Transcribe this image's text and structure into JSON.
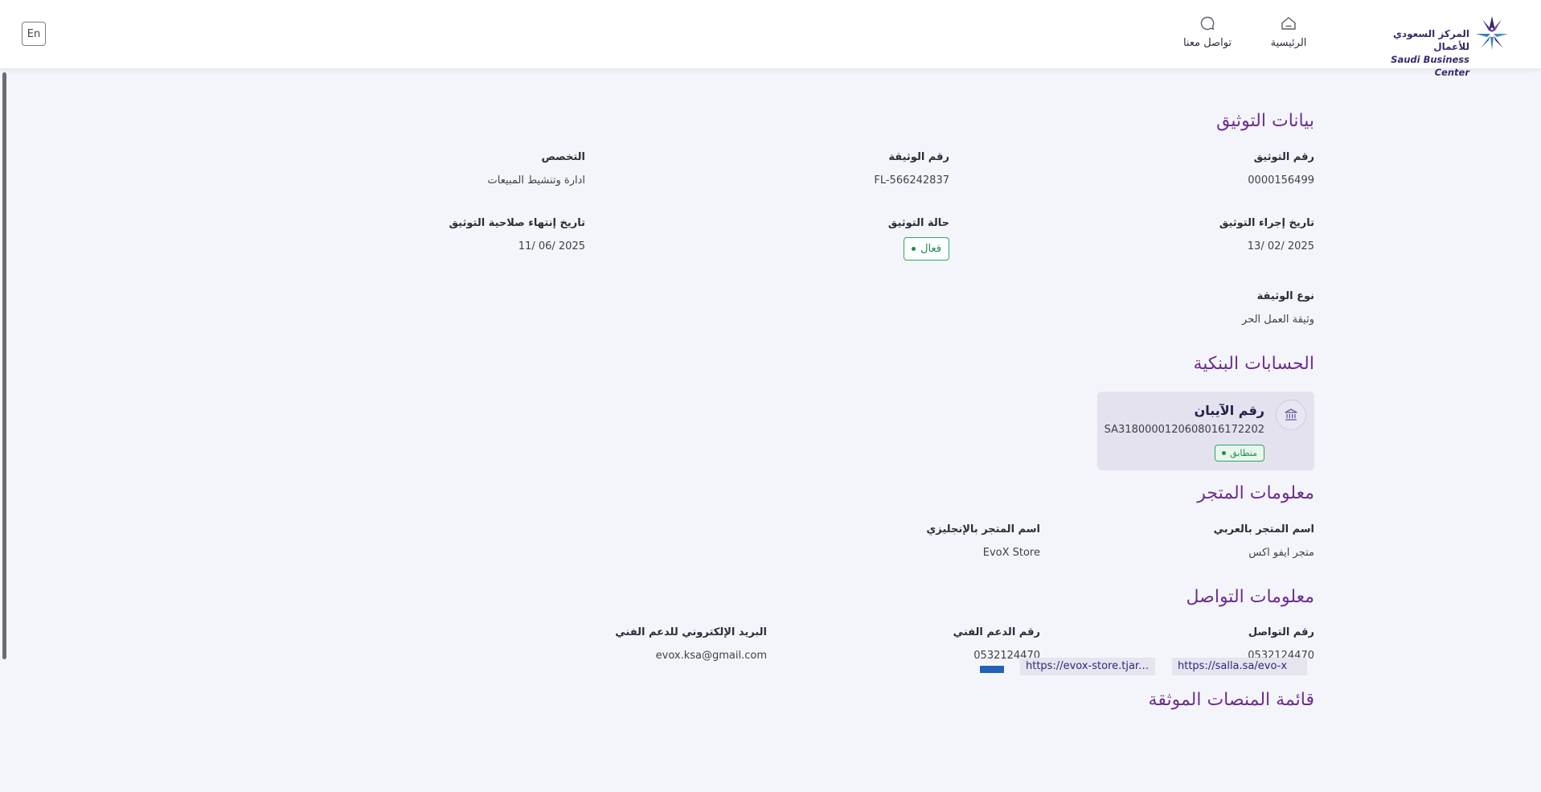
{
  "header": {
    "lang_button": "En",
    "nav": {
      "home_label": "الرئيسية",
      "home_icon": "home-icon",
      "contact_label": "تواصل معنا",
      "contact_icon": "chat-bubble-icon"
    },
    "logo": {
      "arabic": "المركز السعودي للأعمال",
      "english": "Saudi Business Center"
    }
  },
  "verification": {
    "title": "بيانات التوثيق",
    "fields": {
      "verification_number": {
        "label": "رقم التوثيق",
        "value": "0000156499"
      },
      "document_number": {
        "label": "رقم الوثيقة",
        "value": "FL-566242837"
      },
      "specialization": {
        "label": "التخصص",
        "value": "ادارة وتنشيط المبيعات"
      },
      "verification_date": {
        "label": "تاريخ إجراء التوثيق",
        "value": "2025 /02 /13"
      },
      "verification_status": {
        "label": "حالة التوثيق",
        "value": "فعال"
      },
      "expiry_date": {
        "label": "تاريخ إنتهاء صلاحية التوثيق",
        "value": "2025 /06 /11"
      },
      "document_type": {
        "label": "نوع الوثيقة",
        "value": "وثيقة العمل الحر"
      }
    }
  },
  "bank": {
    "title": "الحسابات البنكية",
    "card": {
      "title": "رقم الآيبان",
      "iban": "SA3180000120608016172202",
      "status": "متطابق",
      "icon": "bank-icon"
    }
  },
  "store": {
    "title": "معلومات المتجر",
    "name_ar": {
      "label": "اسم المتجر بالعربي",
      "value": "متجر ايفو اكس"
    },
    "name_en": {
      "label": "اسم المتجر بالإنجليزي",
      "value": "EvoX Store"
    }
  },
  "contact": {
    "title": "معلومات التواصل",
    "phone": {
      "label": "رقم التواصل",
      "value": "0532124470"
    },
    "support_phone": {
      "label": "رقم الدعم الفني",
      "value": "0532124470"
    },
    "support_email": {
      "label": "البريد الإلكتروني للدعم الفني",
      "value": "evox.ksa@gmail.com"
    }
  },
  "platforms": {
    "title": "قائمة المنصات الموثقة",
    "links": [
      "https://salla.sa/evo-x",
      "https://evox-store.tjar.sa/"
    ]
  },
  "colors": {
    "accent": "#6e2f8e",
    "success": "#1f8f48",
    "background": "#f4f5fb"
  }
}
